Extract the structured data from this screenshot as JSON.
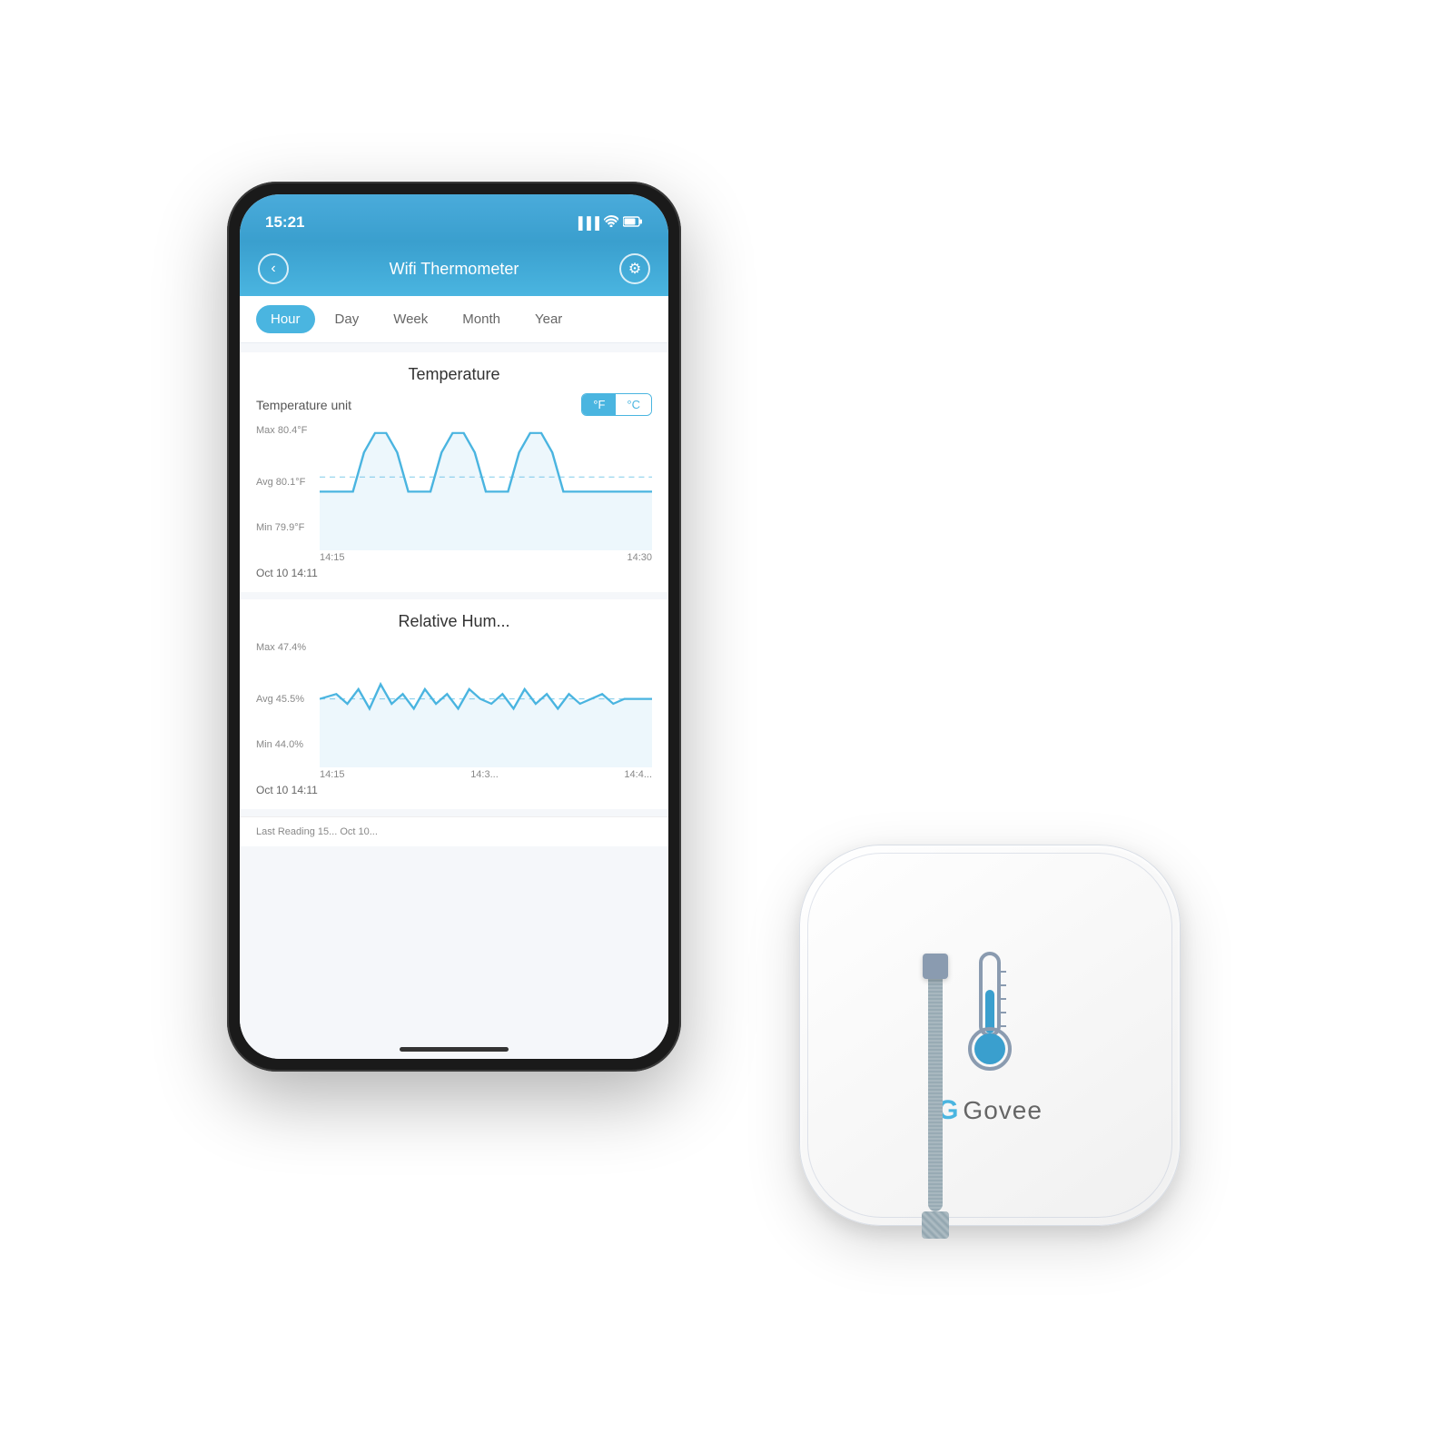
{
  "scene": {
    "background": "#ffffff"
  },
  "phone": {
    "statusBar": {
      "time": "15:21",
      "locationIcon": "▲",
      "signalIcon": "▐▐▐▐",
      "wifiIcon": "WiFi",
      "batteryIcon": "🔋"
    },
    "header": {
      "backLabel": "‹",
      "title": "Wifi Thermometer",
      "gearLabel": "⚙"
    },
    "tabs": [
      {
        "label": "Hour",
        "active": true
      },
      {
        "label": "Day",
        "active": false
      },
      {
        "label": "Week",
        "active": false
      },
      {
        "label": "Month",
        "active": false
      },
      {
        "label": "Year",
        "active": false
      }
    ],
    "temperatureSection": {
      "title": "Temperature",
      "unitLabel": "Temperature unit",
      "unitF": "°F",
      "unitC": "°C",
      "maxLabel": "Max 80.4°F",
      "avgLabel": "Avg 80.1°F",
      "minLabel": "Min 79.9°F",
      "xLabels": [
        "14:15",
        "14:30"
      ],
      "readingDate": "Oct 10  14:11"
    },
    "humiditySection": {
      "title": "Relative Hum...",
      "maxLabel": "Max 47.4%",
      "avgLabel": "Avg 45.5%",
      "minLabel": "Min 44.0%",
      "xLabels": [
        "14:15",
        "14:3...",
        "14:4..."
      ],
      "readingDate": "Oct 10  14:11"
    },
    "bottomBar": {
      "text": "Last Reading 15... Oct 10..."
    }
  },
  "device": {
    "brandName": "Govee",
    "thermometerAlt": "Govee WiFi Temperature Humidity Sensor"
  }
}
